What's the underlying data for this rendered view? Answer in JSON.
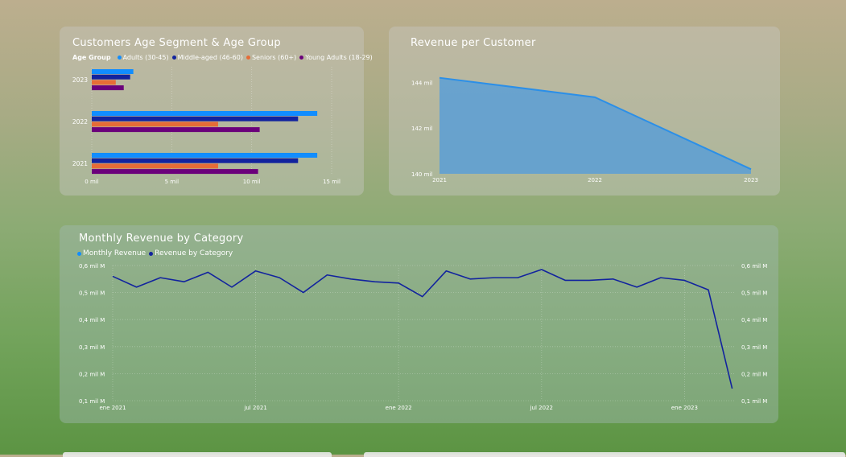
{
  "colors": {
    "adults": "#118dff",
    "middle_aged": "#12239e",
    "seniors": "#e66c37",
    "young_adults": "#6b007b",
    "area_line": "#2b8fe8",
    "area_fill": "#5a9fd6",
    "monthly_line": "#12239e",
    "monthly_revenue_dot": "#118dff"
  },
  "charts": {
    "age": {
      "title": "Customers Age Segment & Age Group",
      "legend_title": "Age Group",
      "legend": [
        "Adults (30-45)",
        "Middle-aged (46-60)",
        "Seniors (60+)",
        "Young Adults (18-29)"
      ],
      "x_ticks": [
        "0 mil",
        "5 mil",
        "10 mil",
        "15 mil"
      ]
    },
    "rpc": {
      "title": "Revenue per Customer",
      "y_ticks": [
        "144 mil",
        "142 mil",
        "140 mil"
      ],
      "x_ticks": [
        "2021",
        "2022",
        "2023"
      ]
    },
    "monthly": {
      "title": "Monthly Revenue by Category",
      "legend": [
        "Monthly Revenue",
        "Revenue by Category"
      ],
      "y_ticks_left": [
        "0,6 mil M",
        "0,5 mil M",
        "0,4 mil M",
        "0,3 mil M",
        "0,2 mil M",
        "0,1 mil M"
      ],
      "y_ticks_right": [
        "0,6 mil M",
        "0,5 mil M",
        "0,4 mil M",
        "0,3 mil M",
        "0,2 mil M",
        "0,1 mil M"
      ],
      "x_ticks": [
        "ene 2021",
        "jul 2021",
        "ene 2022",
        "jul 2022",
        "ene 2023"
      ]
    }
  },
  "chart_data": [
    {
      "type": "bar",
      "orientation": "horizontal",
      "title": "Customers Age Segment & Age Group",
      "categories": [
        "2023",
        "2022",
        "2021"
      ],
      "series": [
        {
          "name": "Adults (30-45)",
          "values": [
            2.6,
            14.1,
            14.1
          ]
        },
        {
          "name": "Middle-aged (46-60)",
          "values": [
            2.4,
            12.9,
            12.9
          ]
        },
        {
          "name": "Seniors (60+)",
          "values": [
            1.5,
            7.9,
            7.9
          ]
        },
        {
          "name": "Young Adults (18-29)",
          "values": [
            2.0,
            10.5,
            10.4
          ]
        }
      ],
      "xlim": [
        0,
        15
      ],
      "x_unit": "mil",
      "legend_position": "top"
    },
    {
      "type": "area",
      "title": "Revenue per Customer",
      "x": [
        "2021",
        "2022",
        "2023"
      ],
      "values": [
        144.2,
        143.35,
        140.2
      ],
      "ylim": [
        140,
        144.4
      ],
      "y_unit": "mil"
    },
    {
      "type": "line",
      "title": "Monthly Revenue by Category",
      "legend_position": "top-left",
      "x_ticks": [
        "ene 2021",
        "jul 2021",
        "ene 2022",
        "jul 2022",
        "ene 2023"
      ],
      "series": [
        {
          "name": "Revenue by Category",
          "x": [
            "2021-01",
            "2021-02",
            "2021-03",
            "2021-04",
            "2021-05",
            "2021-06",
            "2021-07",
            "2021-08",
            "2021-09",
            "2021-10",
            "2021-11",
            "2021-12",
            "2022-01",
            "2022-02",
            "2022-03",
            "2022-04",
            "2022-05",
            "2022-06",
            "2022-07",
            "2022-08",
            "2022-09",
            "2022-10",
            "2022-11",
            "2022-12",
            "2023-01",
            "2023-02",
            "2023-03"
          ],
          "values": [
            0.56,
            0.52,
            0.555,
            0.54,
            0.575,
            0.52,
            0.58,
            0.555,
            0.5,
            0.565,
            0.55,
            0.54,
            0.535,
            0.485,
            0.58,
            0.55,
            0.555,
            0.555,
            0.585,
            0.545,
            0.545,
            0.55,
            0.52,
            0.555,
            0.545,
            0.51,
            0.145
          ]
        }
      ],
      "ylim": [
        0.1,
        0.6
      ],
      "y_unit": "mil M"
    }
  ]
}
